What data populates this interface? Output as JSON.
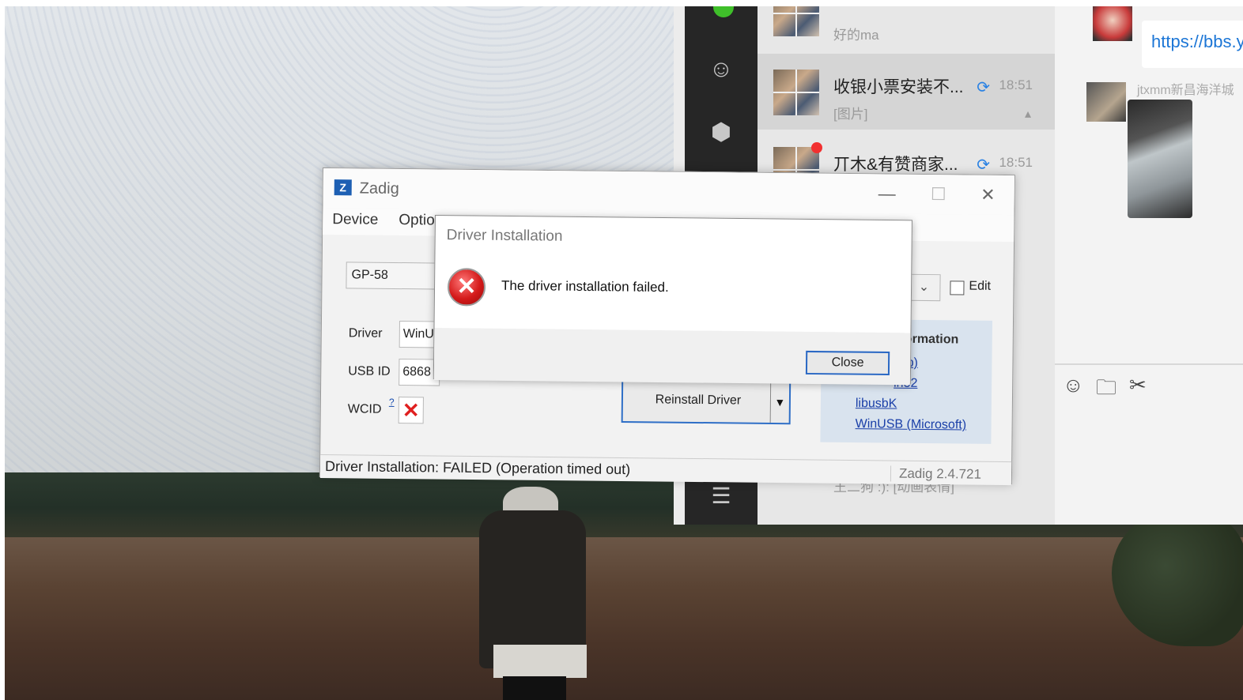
{
  "zadig": {
    "title": "Zadig",
    "menu": {
      "device": "Device",
      "options": "Options"
    },
    "device_value": "GP-58",
    "edit_label": "Edit",
    "driver_label": "Driver",
    "driver_value": "WinU",
    "usbid_label": "USB ID",
    "usbid_value": "6868",
    "wcid_label": "WCID",
    "wcid_help": "?",
    "wcid_mark": "✕",
    "reinstall_label": "Reinstall Driver",
    "info_title": "nformation",
    "links": [
      "(libusb)",
      "in32",
      "libusbK",
      "WinUSB (Microsoft)"
    ],
    "status": "Driver Installation: FAILED (Operation timed out)",
    "version": "Zadig 2.4.721"
  },
  "dialog": {
    "title": "Driver Installation",
    "message": "The driver installation failed.",
    "close_label": "Close"
  },
  "chat": {
    "items": [
      {
        "name": "",
        "preview": "好的ma",
        "time": ""
      },
      {
        "name": "收银小票安装不...",
        "preview": "[图片]",
        "time": "18:51"
      },
      {
        "name": "丌木&有赞商家...",
        "preview": "",
        "time": "18:51"
      },
      {
        "name": "",
        "preview": "王二狗 :): [动画表情]",
        "time": ""
      }
    ],
    "link_text": "https://bbs.y",
    "sender_name": "jtxmm新昌海洋城"
  },
  "icons": {
    "contacts": "contacts-icon",
    "box": "box-icon",
    "menu": "menu-icon",
    "emoji": "emoji-icon",
    "folder": "folder-icon",
    "scissors": "scissors-icon",
    "error": "error-icon"
  }
}
